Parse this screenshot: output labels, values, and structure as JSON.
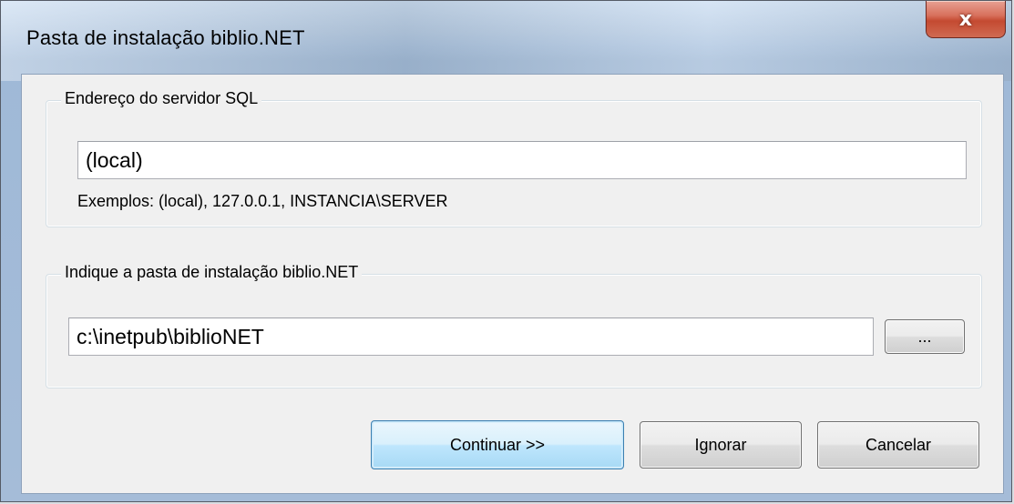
{
  "window": {
    "title": "Pasta de instalação biblio.NET",
    "close_label": "x"
  },
  "sql_group": {
    "legend": "Endereço do servidor SQL",
    "server_value": "(local)",
    "examples": "Exemplos: (local), 127.0.0.1, INSTANCIA\\SERVER"
  },
  "folder_group": {
    "legend": "Indique a pasta de instalação biblio.NET",
    "folder_value": "c:\\inetpub\\biblioNET",
    "browse_label": "..."
  },
  "buttons": {
    "continue_label": "Continuar >>",
    "ignore_label": "Ignorar",
    "cancel_label": "Cancelar"
  }
}
